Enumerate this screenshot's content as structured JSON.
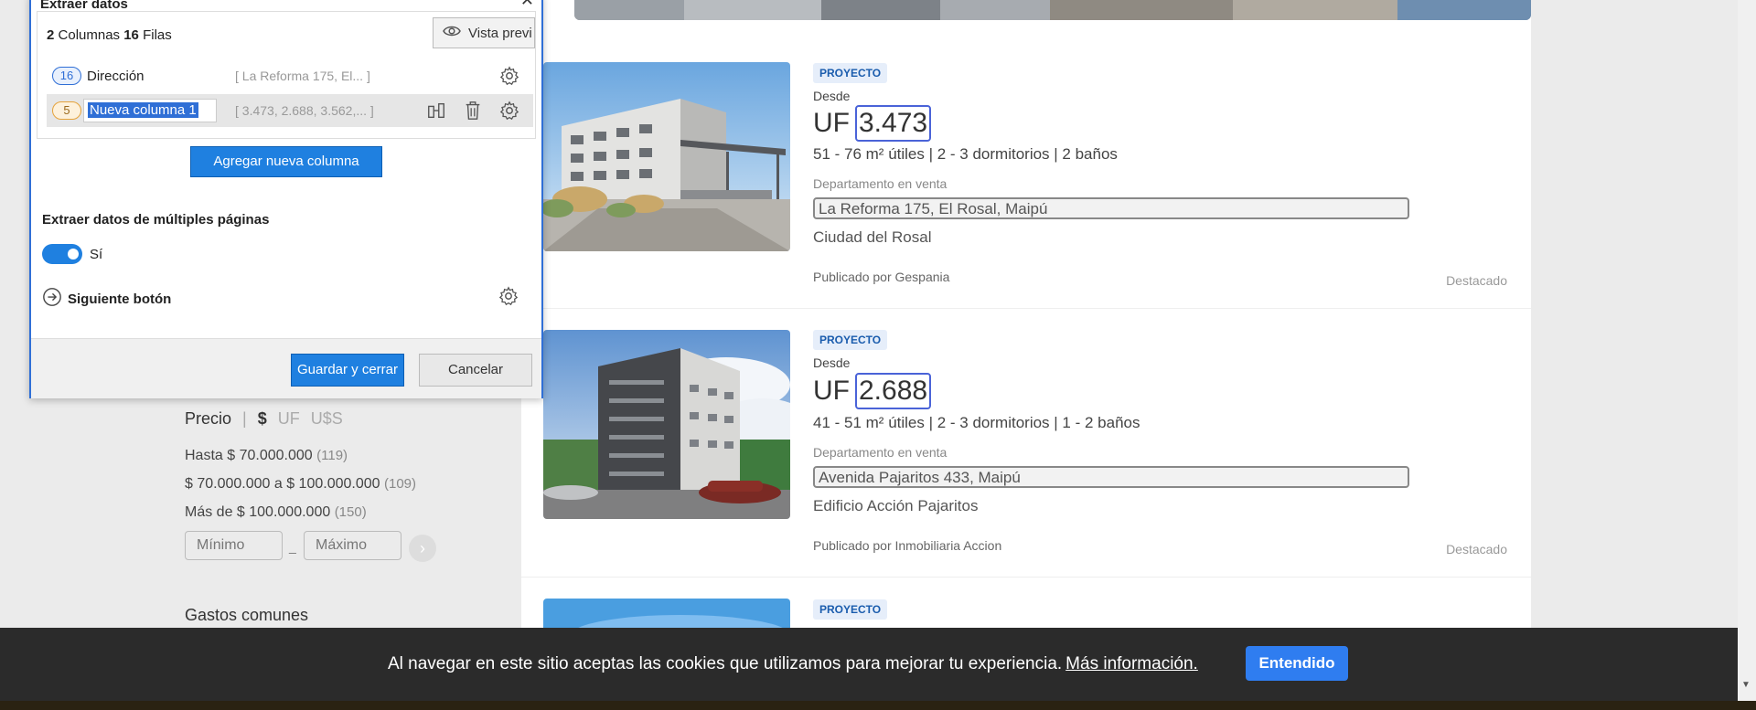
{
  "dialog": {
    "title": "Extraer datos",
    "column_count": "2",
    "columns_word": "Columnas",
    "row_count": "16",
    "rows_word": "Filas",
    "preview_label": "Vista previ",
    "columns": [
      {
        "count": "16",
        "name": "Dirección",
        "sample": "[ La Reforma 175, El...  ]"
      },
      {
        "count": "5",
        "name": "Nueva columna 1",
        "sample": "[ 3.473, 2.688, 3.562,... ]"
      }
    ],
    "add_column_label": "Agregar nueva columna",
    "multi_page_title": "Extraer datos de múltiples páginas",
    "toggle_label": "Sí",
    "next_button_label": "Siguiente botón",
    "save_label": "Guardar y cerrar",
    "cancel_label": "Cancelar"
  },
  "filters": {
    "price_title": "Precio",
    "separator": "|",
    "currencies": [
      "$",
      "UF",
      "U$S"
    ],
    "options": [
      {
        "label": "Hasta $ 70.000.000",
        "count": "(119)"
      },
      {
        "label": "$ 70.000.000 a $ 100.000.000",
        "count": "(109)"
      },
      {
        "label": "Más de $ 100.000.000",
        "count": "(150)"
      }
    ],
    "min_placeholder": "Mínimo",
    "dash": "_",
    "max_placeholder": "Máximo",
    "go_icon": "›",
    "common_expenses_title": "Gastos comunes"
  },
  "listings": [
    {
      "badge": "PROYECTO",
      "from_label": "Desde",
      "currency": "UF",
      "price": "3.473",
      "features": "51 - 76 m² útiles | 2 - 3 dormitorios | 2 baños",
      "type": "Departamento en venta",
      "address": "La Reforma 175, El Rosal, Maipú",
      "project": "Ciudad del Rosal",
      "publisher": "Publicado por Gespania",
      "highlight": "Destacado"
    },
    {
      "badge": "PROYECTO",
      "from_label": "Desde",
      "currency": "UF",
      "price": "2.688",
      "features": "41 - 51 m² útiles | 2 - 3 dormitorios | 1 - 2 baños",
      "type": "Departamento en venta",
      "address": "Avenida Pajaritos 433, Maipú",
      "project": "Edificio Acción Pajaritos",
      "publisher": "Publicado por Inmobiliaria Accion",
      "highlight": "Destacado"
    },
    {
      "badge": "PROYECTO"
    }
  ],
  "cookie": {
    "text": "Al navegar en este sitio aceptas las cookies que utilizamos para mejorar tu experiencia.",
    "link": "Más información.",
    "button": "Entendido"
  },
  "colors": {
    "accent": "#1f80e0",
    "dialog_border": "#2f6fd6",
    "price_highlight": "#4a63d8",
    "cookie_bg": "#2b2b2b",
    "badge_bg": "#e6eefa"
  }
}
